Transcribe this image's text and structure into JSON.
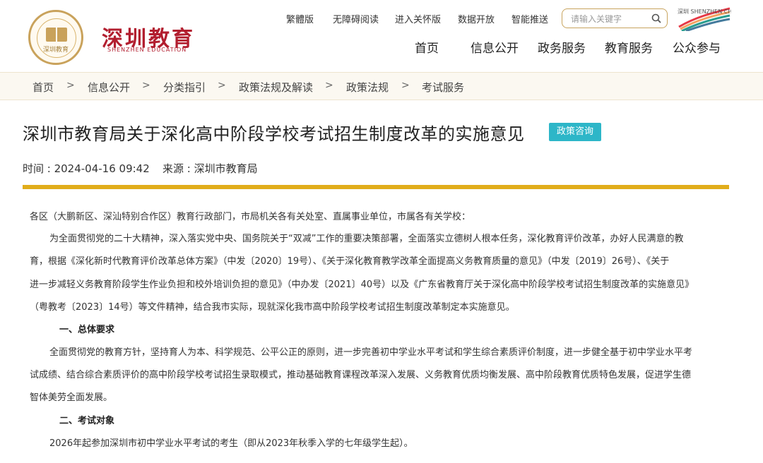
{
  "header": {
    "logo_emblem_text": "深圳教育",
    "logo_cn": "深圳教育",
    "logo_en": "SHENZHEN EDUCATION",
    "top_links": [
      "繁體版",
      "无障碍阅读",
      "进入关怀版",
      "数据开放",
      "智能推送"
    ],
    "search_placeholder": "请输入关键字",
    "brand_right": "深圳 SHENZHEN CHINA",
    "nav": [
      "首页",
      "信息公开",
      "政务服务",
      "教育服务",
      "公众参与"
    ]
  },
  "breadcrumb": [
    "首页",
    "信息公开",
    "分类指引",
    "政策法规及解读",
    "政策法规",
    "考试服务"
  ],
  "breadcrumb_sep": ">",
  "article": {
    "title": "深圳市教育局关于深化高中阶段学校考试招生制度改革的实施意见",
    "tag": "政策咨询",
    "time": "时间 : 2024-04-16 09:42",
    "source": "来源 : 深圳市教育局",
    "lines": [
      "各区（大鹏新区、深汕特别合作区）教育行政部门，市局机关各有关处室、直属事业单位，市属各有关学校：",
      "为全面贯彻党的二十大精神，深入落实党中央、国务院关于“双减”工作的重要决策部署，全面落实立德树人根本任务，深化教育评价改革，办好人民满意的教",
      "育，根据《深化新时代教育评价改革总体方案》（中发〔2020〕19号）、《关于深化教育教学改革全面提高义务教育质量的意见》（中发〔2019〕26号）、《关于",
      "进一步减轻义务教育阶段学生作业负担和校外培训负担的意见》（中办发〔2021〕40号）以及《广东省教育厅关于深化高中阶段学校考试招生制度改革的实施意见》",
      "（粤教考〔2023〕14号）等文件精神，结合我市实际，现就深化我市高中阶段学校考试招生制度改革制定本实施意见。",
      "一、总体要求",
      "全面贯彻党的教育方针，坚持育人为本、科学规范、公平公正的原则，进一步完善初中学业水平考试和学生综合素质评价制度，进一步健全基于初中学业水平考",
      "试成绩、结合综合素质评价的高中阶段学校考试招生录取模式，推动基础教育课程改革深入发展、义务教育优质均衡发展、高中阶段教育优质特色发展，促进学生德",
      "智体美劳全面发展。",
      "二、考试对象",
      "2026年起参加深圳市初中学业水平考试的考生（即从2023年秋季入学的七年级学生起）。"
    ]
  },
  "colors": {
    "brand_red": "#b21e2f",
    "gold": "#e1ad1a",
    "tag_bg": "#2db6c8"
  }
}
